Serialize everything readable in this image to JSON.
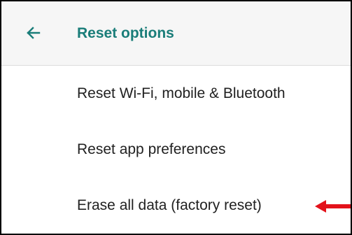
{
  "app_bar": {
    "back_icon": "arrow-left-icon",
    "title": "Reset options",
    "accent_color": "#1a7d79",
    "background_color": "#f6f6f6"
  },
  "list": {
    "items": [
      {
        "label": "Reset Wi-Fi, mobile & Bluetooth"
      },
      {
        "label": "Reset app preferences"
      },
      {
        "label": "Erase all data (factory reset)"
      }
    ]
  },
  "annotation": {
    "icon": "red-arrow-icon",
    "color": "#e3121b"
  }
}
